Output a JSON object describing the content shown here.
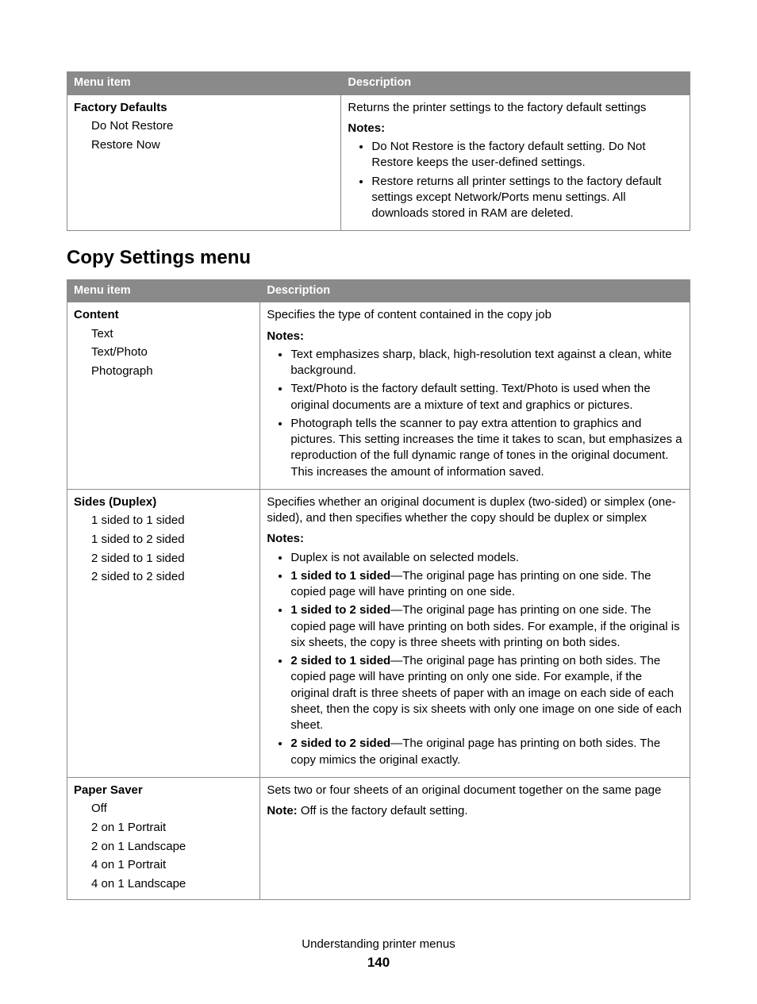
{
  "table1": {
    "headers": {
      "menu": "Menu item",
      "desc": "Description"
    },
    "rows": [
      {
        "title": "Factory Defaults",
        "subs": [
          "Do Not Restore",
          "Restore Now"
        ],
        "desc_lead": "Returns the printer settings to the factory default settings",
        "notes_label": "Notes:",
        "notes": [
          {
            "text": "Do Not Restore is the factory default setting. Do Not Restore keeps the user-defined settings."
          },
          {
            "text": "Restore returns all printer settings to the factory default settings except Network/Ports menu settings. All downloads stored in RAM are deleted."
          }
        ]
      }
    ]
  },
  "section_heading": "Copy Settings menu",
  "table2": {
    "headers": {
      "menu": "Menu item",
      "desc": "Description"
    },
    "rows": [
      {
        "title": "Content",
        "subs": [
          "Text",
          "Text/Photo",
          "Photograph"
        ],
        "desc_lead": "Specifies the type of content contained in the copy job",
        "notes_label": "Notes:",
        "notes": [
          {
            "text": "Text emphasizes sharp, black, high-resolution text against a clean, white background."
          },
          {
            "text": "Text/Photo is the factory default setting. Text/Photo is used when the original documents are a mixture of text and graphics or pictures."
          },
          {
            "text": "Photograph tells the scanner to pay extra attention to graphics and pictures. This setting increases the time it takes to scan, but emphasizes a reproduction of the full dynamic range of tones in the original document. This increases the amount of information saved."
          }
        ]
      },
      {
        "title": "Sides (Duplex)",
        "subs": [
          "1 sided to 1 sided",
          "1 sided to 2 sided",
          "2 sided to 1 sided",
          "2 sided to 2 sided"
        ],
        "desc_lead": "Specifies whether an original document is duplex (two-sided) or simplex (one-sided), and then specifies whether the copy should be duplex or simplex",
        "notes_label": "Notes:",
        "notes": [
          {
            "text": "Duplex is not available on selected models."
          },
          {
            "prefix": "1 sided to 1 sided",
            "text": "—The original page has printing on one side. The copied page will have printing on one side."
          },
          {
            "prefix": "1 sided to 2 sided",
            "text": "—The original page has printing on one side. The copied page will have printing on both sides. For example, if the original is six sheets, the copy is three sheets with printing on both sides."
          },
          {
            "prefix": "2 sided to 1 sided",
            "text": "—The original page has printing on both sides. The copied page will have printing on only one side. For example, if the original draft is three sheets of paper with an image on each side of each sheet, then the copy is six sheets with only one image on one side of each sheet."
          },
          {
            "prefix": "2 sided to 2 sided",
            "text": "—The original page has printing on both sides. The copy mimics the original exactly."
          }
        ]
      },
      {
        "title": "Paper Saver",
        "subs": [
          "Off",
          "2 on 1 Portrait",
          "2 on 1 Landscape",
          "4 on 1 Portrait",
          "4 on 1 Landscape"
        ],
        "desc_lead": "Sets two or four sheets of an original document together on the same page",
        "note_label": "Note:",
        "note_body": " Off is the factory default setting."
      }
    ]
  },
  "footer": {
    "section": "Understanding printer menus",
    "page": "140"
  }
}
